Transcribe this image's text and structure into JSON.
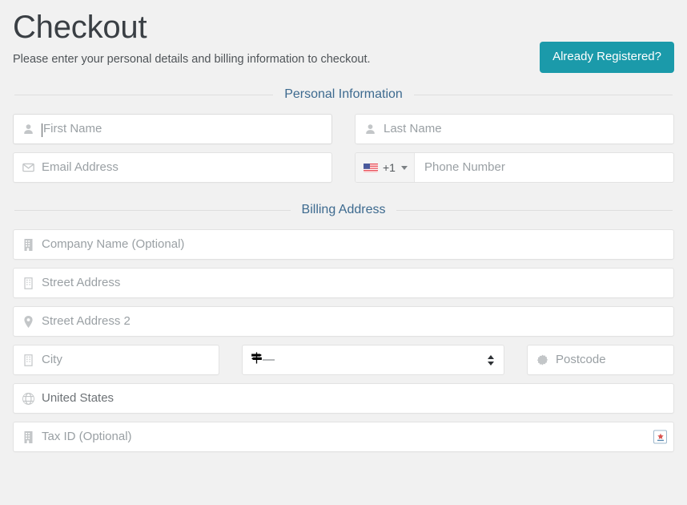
{
  "header": {
    "title": "Checkout",
    "subtitle": "Please enter your personal details and billing information to checkout.",
    "registered_button": "Already Registered?"
  },
  "sections": {
    "personal": {
      "title": "Personal Information"
    },
    "billing": {
      "title": "Billing Address"
    }
  },
  "fields": {
    "first_name": {
      "placeholder": "First Name",
      "value": "",
      "icon": "user-icon"
    },
    "last_name": {
      "placeholder": "Last Name",
      "value": "",
      "icon": "user-icon"
    },
    "email": {
      "placeholder": "Email Address",
      "value": "",
      "icon": "envelope-icon"
    },
    "phone": {
      "placeholder": "Phone Number",
      "value": "",
      "dial_code": "+1",
      "country_flag": "us-flag-icon"
    },
    "company": {
      "placeholder": "Company Name (Optional)",
      "value": "",
      "icon": "building-icon"
    },
    "street1": {
      "placeholder": "Street Address",
      "value": "",
      "icon": "building-icon"
    },
    "street2": {
      "placeholder": "Street Address 2",
      "value": "",
      "icon": "map-pin-icon"
    },
    "city": {
      "placeholder": "City",
      "value": "",
      "icon": "building-icon"
    },
    "state": {
      "selected": "—",
      "icon": "signpost-icon"
    },
    "postcode": {
      "placeholder": "Postcode",
      "value": "",
      "icon": "seal-icon"
    },
    "country": {
      "value": "United States",
      "icon": "globe-icon"
    },
    "tax_id": {
      "placeholder": "Tax ID (Optional)",
      "value": "",
      "icon": "building-icon",
      "badge_icon": "extension-badge-icon"
    }
  },
  "colors": {
    "accent": "#1b9aaa",
    "section_title": "#3d6a8f",
    "page_bg": "#f1f1f1",
    "field_bg": "#ffffff",
    "placeholder": "#9aa0a4"
  }
}
